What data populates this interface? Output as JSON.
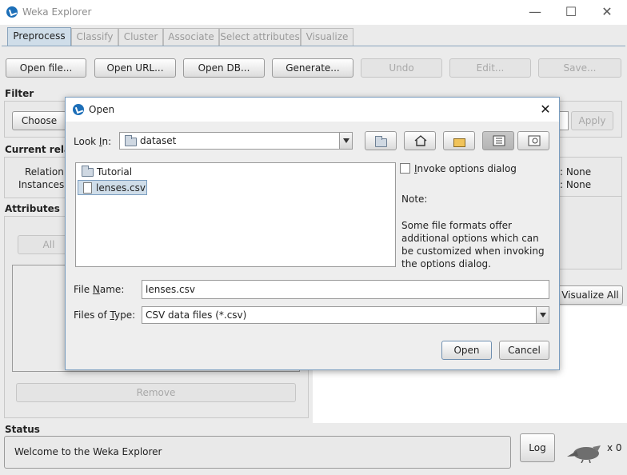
{
  "window": {
    "title": "Weka Explorer",
    "minimize": "—",
    "maximize": "☐",
    "close": "✕"
  },
  "tabs": [
    {
      "label": "Preprocess"
    },
    {
      "label": "Classify"
    },
    {
      "label": "Cluster"
    },
    {
      "label": "Associate"
    },
    {
      "label": "Select attributes"
    },
    {
      "label": "Visualize"
    }
  ],
  "toolbar": {
    "open_file": "Open file...",
    "open_url": "Open URL...",
    "open_db": "Open DB...",
    "generate": "Generate...",
    "undo": "Undo",
    "edit": "Edit...",
    "save": "Save..."
  },
  "filter": {
    "label": "Filter",
    "choose": "Choose",
    "apply": "Apply"
  },
  "current_relation": {
    "label": "Current relati",
    "relation_label": "Relation:",
    "instances_label": "Instances:",
    "right_value_1": ": None",
    "right_value_2": ": None"
  },
  "attributes": {
    "label": "Attributes",
    "all": "All",
    "remove": "Remove"
  },
  "visualize_all": "Visualize All",
  "status": {
    "label": "Status",
    "text": "Welcome to the Weka Explorer",
    "log": "Log",
    "count": "x 0"
  },
  "dialog": {
    "title": "Open",
    "close": "✕",
    "look_in_prefix": "Look ",
    "look_in_key": "I",
    "look_in_suffix": "n:",
    "look_in_value": "dataset",
    "files": [
      {
        "name": "Tutorial",
        "type": "folder"
      },
      {
        "name": "lenses.csv",
        "type": "file"
      }
    ],
    "invoke_key": "I",
    "invoke_rest": "nvoke options dialog",
    "note_title": "Note:",
    "note_text": "Some file formats offer additional options which can be customized when invoking the options dialog.",
    "file_name_prefix": "File ",
    "file_name_key": "N",
    "file_name_suffix": "ame:",
    "file_name_value": "lenses.csv",
    "files_type_prefix": "Files of ",
    "files_type_key": "T",
    "files_type_suffix": "ype:",
    "files_type_value": "CSV data files (*.csv)",
    "open": "Open",
    "cancel": "Cancel"
  }
}
